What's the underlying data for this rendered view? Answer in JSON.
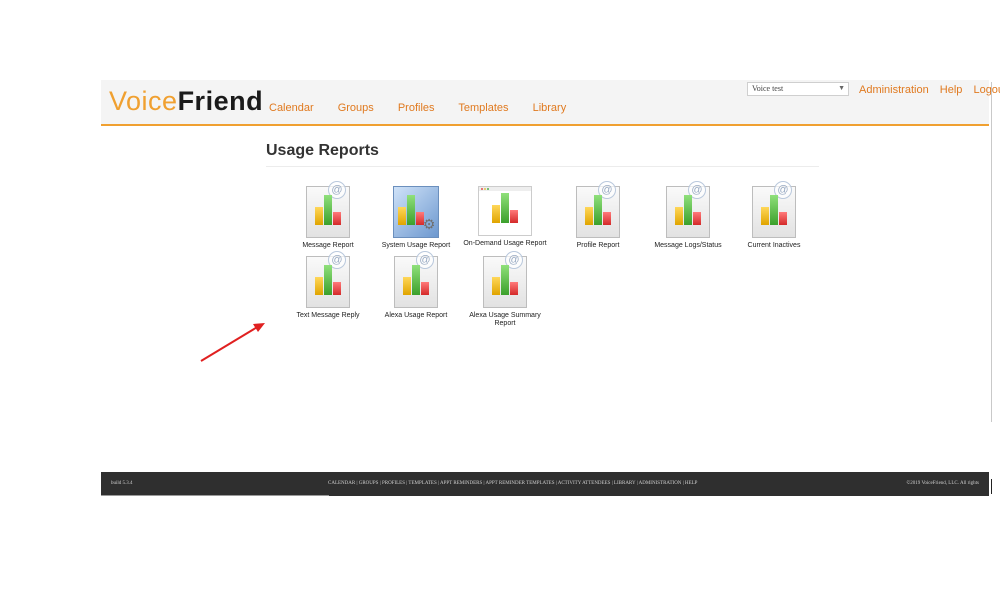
{
  "brand": {
    "light": "Voice",
    "bold": "Friend"
  },
  "nav": [
    {
      "label": "Calendar"
    },
    {
      "label": "Groups"
    },
    {
      "label": "Profiles"
    },
    {
      "label": "Templates"
    },
    {
      "label": "Library"
    }
  ],
  "account_select": {
    "value": "Voice test"
  },
  "top_links": [
    {
      "label": "Administration"
    },
    {
      "label": "Help"
    },
    {
      "label": "Logout"
    }
  ],
  "page_title": "Usage Reports",
  "reports_row1": [
    {
      "label": "Message Report",
      "icon": "chart-document-icon"
    },
    {
      "label": "System Usage Report",
      "icon": "system-usage-icon"
    },
    {
      "label": "On-Demand Usage Report",
      "icon": "chart-window-icon"
    },
    {
      "label": "Profile Report",
      "icon": "chart-document-icon"
    },
    {
      "label": "Message Logs/Status",
      "icon": "chart-document-icon"
    },
    {
      "label": "Current Inactives",
      "icon": "chart-document-icon"
    }
  ],
  "reports_row2": [
    {
      "label": "Text Message Reply",
      "icon": "chart-document-icon"
    },
    {
      "label": "Alexa Usage Report",
      "icon": "chart-document-icon"
    },
    {
      "label": "Alexa Usage Summary Report",
      "icon": "chart-document-icon"
    }
  ],
  "footer": {
    "build": "build 5.3.4",
    "links": "CALENDAR | GROUPS | PROFILES | TEMPLATES | APPT REMINDERS | APPT REMINDER TEMPLATES | ACTIVITY ATTENDEES | LIBRARY | ADMINISTRATION | HELP",
    "copyright": "©2019 VoiceFriend, LLC. All rights"
  },
  "colors": {
    "accent": "#f0a030",
    "link": "#e07a20",
    "footer_bg": "#2f2f2f",
    "annotation": "#e02020"
  }
}
